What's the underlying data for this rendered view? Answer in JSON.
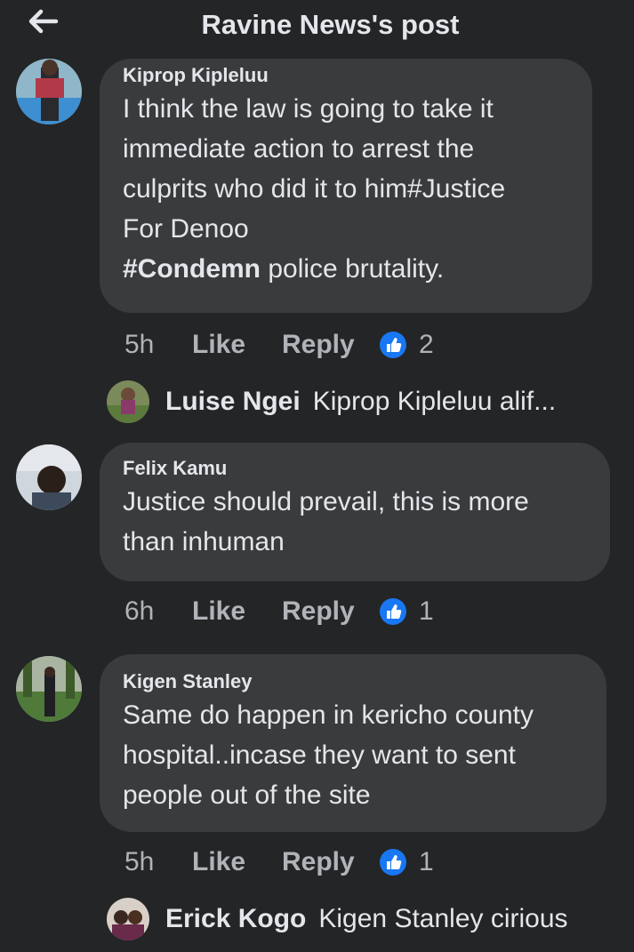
{
  "header": {
    "title": "Ravine News's post",
    "back_icon": "arrow-left-icon"
  },
  "comments": [
    {
      "author": "Kiprop Kipleluu",
      "text_lines": [
        "I think the law is going to take it",
        "immediate action to arrest the",
        "culprits who did it to him#Justice",
        "For Denoo"
      ],
      "text_bold": "#Condemn",
      "text_rest": " police brutality.",
      "time": "5h",
      "like_label": "Like",
      "reply_label": "Reply",
      "reaction_icon": "thumbs-up-icon",
      "reaction_count": "2",
      "reply": {
        "name": "Luise Ngei",
        "text": "Kiprop Kipleluu alif..."
      }
    },
    {
      "author": "Felix Kamu",
      "text_lines": [
        "Justice should prevail, this is more",
        "than inhuman"
      ],
      "time": "6h",
      "like_label": "Like",
      "reply_label": "Reply",
      "reaction_icon": "thumbs-up-icon",
      "reaction_count": "1"
    },
    {
      "author": "Kigen Stanley",
      "text_lines": [
        "Same do happen in kericho county",
        "hospital..incase they want to sent",
        "people out of the site"
      ],
      "time": "5h",
      "like_label": "Like",
      "reply_label": "Reply",
      "reaction_icon": "thumbs-up-icon",
      "reaction_count": "1",
      "reply": {
        "name": "Erick Kogo",
        "text": "Kigen Stanley cirious"
      }
    }
  ],
  "colors": {
    "background": "#242526",
    "bubble": "#3a3b3c",
    "text": "#e4e6eb",
    "secondary_text": "#b0b3b8",
    "like_blue": "#1877f2"
  }
}
